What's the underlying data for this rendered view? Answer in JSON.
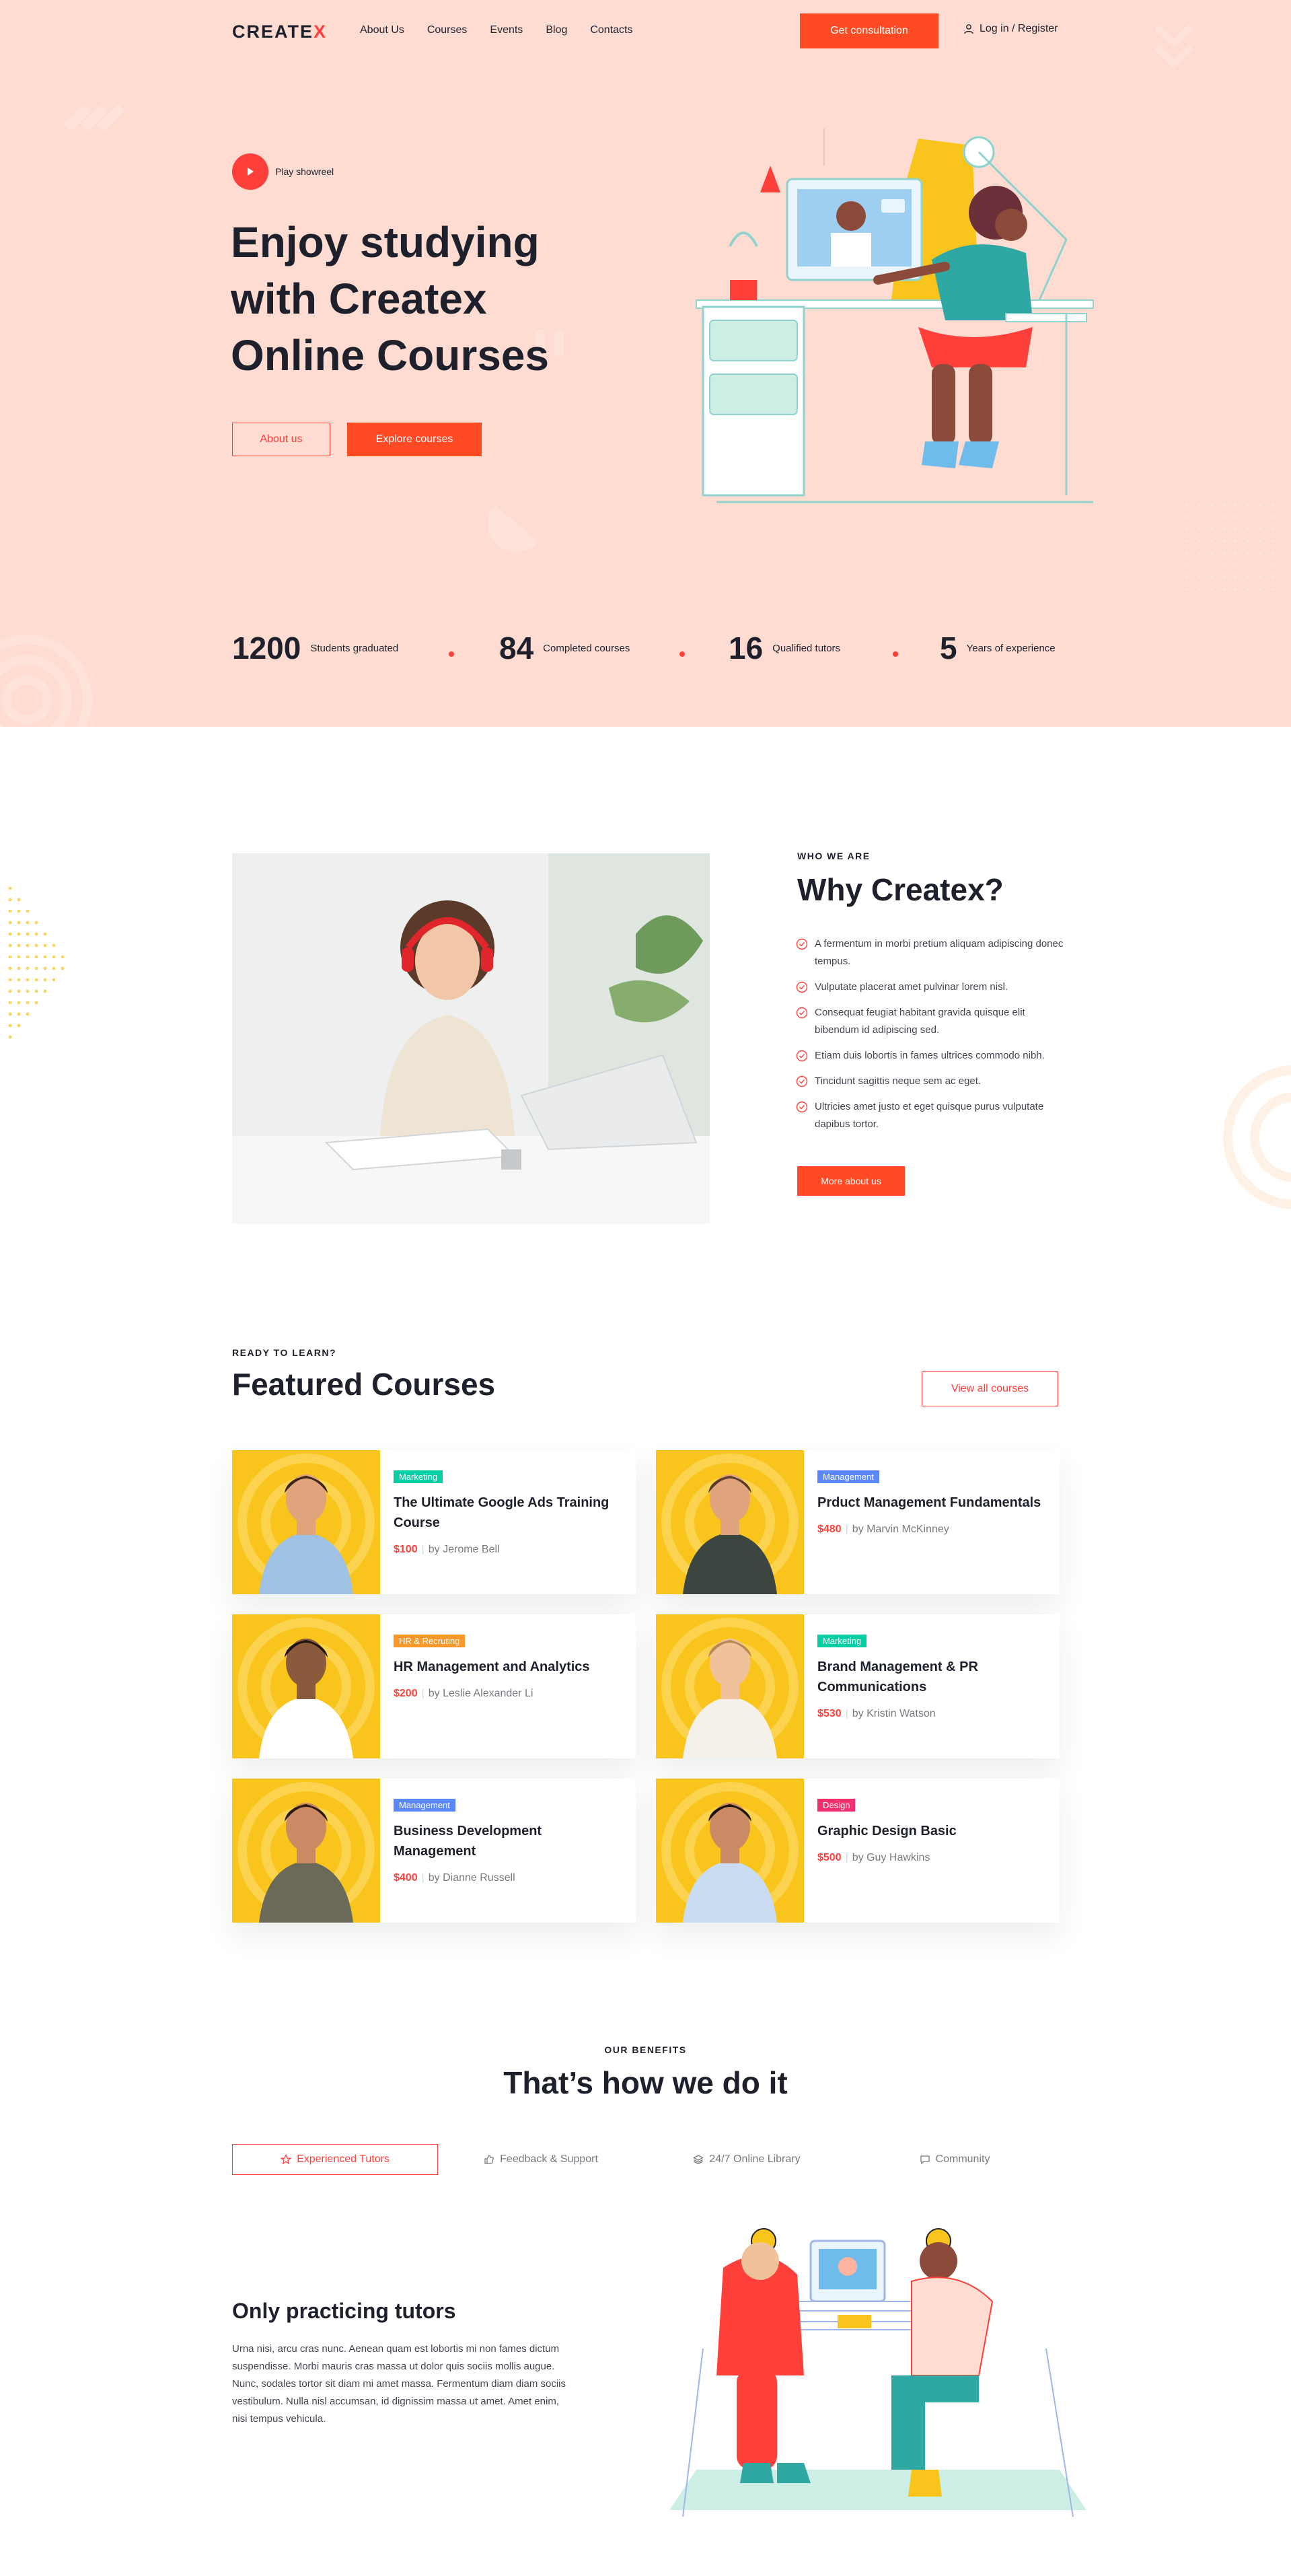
{
  "header": {
    "logo_text": "CREATE",
    "logo_x": "X",
    "nav": [
      "About Us",
      "Courses",
      "Events",
      "Blog",
      "Contacts"
    ],
    "cta_label": "Get consultation",
    "login_label": "Log in / Register"
  },
  "hero": {
    "showreel_label": "Play showreel",
    "title_line1": "Enjoy studying",
    "title_line2": "with Createx",
    "title_line3": "Online Courses",
    "btn_about": "About us",
    "btn_explore": "Explore courses",
    "stats": [
      {
        "num": "1200",
        "label": "Students graduated"
      },
      {
        "num": "84",
        "label": "Completed courses"
      },
      {
        "num": "16",
        "label": "Qualified tutors"
      },
      {
        "num": "5",
        "label": "Years of experience"
      }
    ]
  },
  "why": {
    "eyebrow": "WHO WE ARE",
    "title": "Why Createx?",
    "items": [
      "A fermentum in morbi pretium aliquam adipiscing donec tempus.",
      "Vulputate placerat amet pulvinar lorem nisl.",
      "Consequat feugiat habitant gravida quisque elit bibendum id adipiscing sed.",
      "Etiam duis lobortis in fames ultrices commodo nibh.",
      "Tincidunt sagittis neque sem ac eget.",
      "Ultricies amet justo et eget quisque purus vulputate dapibus tortor."
    ],
    "button": "More about us"
  },
  "courses": {
    "eyebrow": "READY TO LEARN?",
    "title": "Featured Courses",
    "view_all": "View all courses",
    "items": [
      {
        "tag": "Marketing",
        "tag_color": "#03cea4",
        "title": "The Ultimate Google Ads Training Course",
        "price": "$100",
        "author": "by Jerome Bell",
        "shirt": "#9ec1e4",
        "skin": "#e0a47c",
        "hair": "#3a2518"
      },
      {
        "tag": "Management",
        "tag_color": "#5a87fc",
        "title": "Prduct Management Fundamentals",
        "price": "$480",
        "author": "by Marvin McKinney",
        "shirt": "#3d4540",
        "skin": "#e0a47c",
        "hair": "#5a3b28"
      },
      {
        "tag": "HR & Recruting",
        "tag_color": "#f89828",
        "title": "HR  Management and Analytics",
        "price": "$200",
        "author": "by Leslie Alexander Li",
        "shirt": "#ffffff",
        "skin": "#8a5a3c",
        "hair": "#1f1410"
      },
      {
        "tag": "Marketing",
        "tag_color": "#03cea4",
        "title": "Brand Management & PR Communications",
        "price": "$530",
        "author": "by Kristin Watson",
        "shirt": "#f4f1ea",
        "skin": "#f0c29c",
        "hair": "#b98656"
      },
      {
        "tag": "Management",
        "tag_color": "#5a87fc",
        "title": "Business Development Management",
        "price": "$400",
        "author": "by Dianne Russell",
        "shirt": "#6b6a58",
        "skin": "#c98a64",
        "hair": "#2b1b14"
      },
      {
        "tag": "Design",
        "tag_color": "#f52f6e",
        "title": "Graphic Design Basic",
        "price": "$500",
        "author": "by Guy Hawkins",
        "shirt": "#c9dcf2",
        "skin": "#c98a64",
        "hair": "#1f1410"
      }
    ]
  },
  "benefits": {
    "eyebrow": "OUR BENEFITS",
    "title": "That’s how we do it",
    "tabs": [
      {
        "label": "Experienced Tutors",
        "icon": "star-icon"
      },
      {
        "label": "Feedback & Support",
        "icon": "thumbs-up-icon"
      },
      {
        "label": "24/7 Online Library",
        "icon": "layers-icon"
      },
      {
        "label": "Community",
        "icon": "chat-icon"
      }
    ],
    "panel_title": "Only practicing tutors",
    "panel_text": "Urna nisi, arcu cras nunc. Aenean quam est lobortis mi non fames dictum suspendisse. Morbi mauris cras massa ut dolor quis sociis mollis augue. Nunc, sodales tortor sit diam mi amet massa. Fermentum diam diam sociis vestibulum. Nulla nisl accumsan, id dignissim massa ut amet. Amet enim, nisi tempus vehicula."
  },
  "colors": {
    "accent": "#ff3f3a",
    "cta": "#ff4a23",
    "hero_bg": "#ffdcd2",
    "course_img_bg": "#f9c51d"
  }
}
